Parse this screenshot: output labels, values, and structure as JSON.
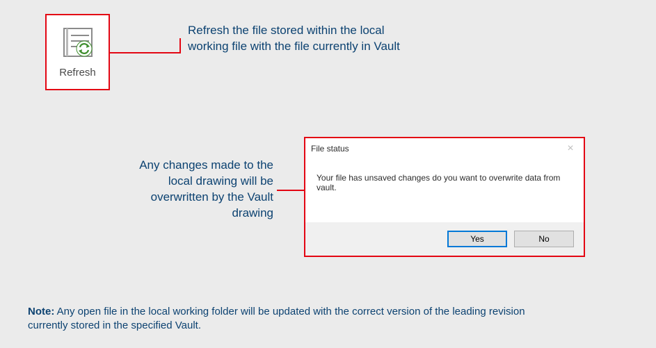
{
  "tool": {
    "label": "Refresh",
    "icon_name": "refresh-icon"
  },
  "desc1": "Refresh the file stored within the local working file with the file currently in Vault",
  "desc2": "Any changes made to the local drawing will be overwritten by the Vault drawing",
  "dialog": {
    "title": "File status",
    "message": "Your file has unsaved changes do you want to overwrite data from vault.",
    "yes": "Yes",
    "no": "No"
  },
  "note": {
    "label": "Note:",
    "text": " Any open file in the local working folder will be updated with the correct version of the leading revision currently stored in the specified Vault."
  },
  "colors": {
    "callout_border": "#e30613",
    "text_blue": "#0c4271",
    "button_focus": "#0078d7"
  }
}
